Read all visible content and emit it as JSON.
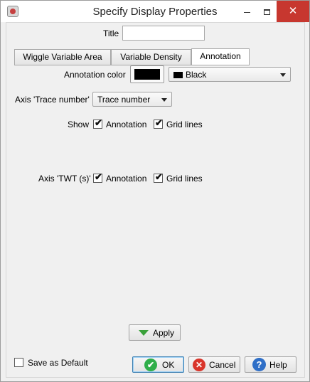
{
  "window": {
    "title": "Specify Display Properties",
    "close_glyph": "✕"
  },
  "form": {
    "title_label": "Title",
    "title_value": ""
  },
  "tabs": [
    {
      "label": "Wiggle Variable Area",
      "selected": false
    },
    {
      "label": "Variable Density",
      "selected": false
    },
    {
      "label": "Annotation",
      "selected": true
    }
  ],
  "annotation": {
    "color_label": "Annotation color",
    "color_value": "#000000",
    "color_select": "Black",
    "trace_axis_label": "Axis 'Trace number'",
    "trace_axis_select": "Trace number",
    "show_label": "Show",
    "show_annotation_label": "Annotation",
    "show_annotation_checked": true,
    "show_grid_label": "Grid lines",
    "show_grid_checked": true,
    "twt_axis_label": "Axis 'TWT (s)'",
    "twt_annotation_label": "Annotation",
    "twt_annotation_checked": true,
    "twt_grid_label": "Grid lines",
    "twt_grid_checked": true
  },
  "buttons": {
    "apply": "Apply",
    "ok": "OK",
    "cancel": "Cancel",
    "help": "Help"
  },
  "footer": {
    "save_default_label": "Save as Default",
    "save_default_checked": false
  },
  "icons": {
    "check_glyph": "✔",
    "ok_glyph": "✔",
    "cancel_glyph": "✕",
    "help_glyph": "?",
    "ok_color": "#2fae4a",
    "cancel_color": "#d9352b",
    "help_color": "#2f6fc7",
    "apply_color": "#3aa13a"
  }
}
